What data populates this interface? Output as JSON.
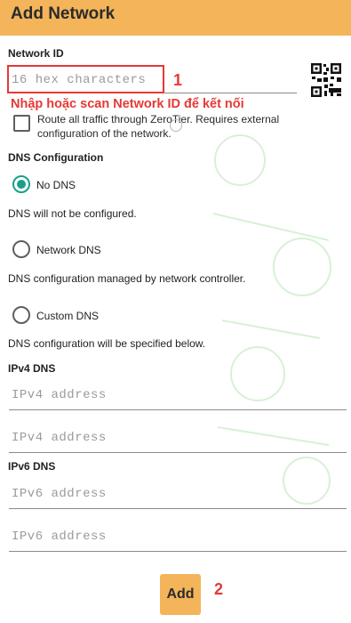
{
  "header": {
    "title": "Add Network"
  },
  "network_id": {
    "label": "Network ID",
    "placeholder": "16 hex characters",
    "annotation_number": "1",
    "annotation_text": "Nhập hoặc scan Network ID để kết nối"
  },
  "qr": {
    "icon": "qr-code-icon"
  },
  "route_all": {
    "label": "Route all traffic through ZeroTier. Requires external configuration of the network.",
    "checked": false
  },
  "dns": {
    "section_label": "DNS Configuration",
    "options": [
      {
        "label": "No DNS",
        "description": "DNS will not be configured.",
        "selected": true
      },
      {
        "label": "Network DNS",
        "description": "DNS configuration managed by network controller.",
        "selected": false
      },
      {
        "label": "Custom DNS",
        "description": "DNS configuration will be specified below.",
        "selected": false
      }
    ]
  },
  "ipv4": {
    "label": "IPv4 DNS",
    "fields": [
      {
        "placeholder": "IPv4 address"
      },
      {
        "placeholder": "IPv4 address"
      }
    ]
  },
  "ipv6": {
    "label": "IPv6 DNS",
    "fields": [
      {
        "placeholder": "IPv6 address"
      },
      {
        "placeholder": "IPv6 address"
      }
    ]
  },
  "add_button": {
    "label": "Add",
    "annotation_number": "2"
  },
  "colors": {
    "appbar": "#f3b45a",
    "accent": "#1aa08a",
    "annotation": "#e53935"
  }
}
